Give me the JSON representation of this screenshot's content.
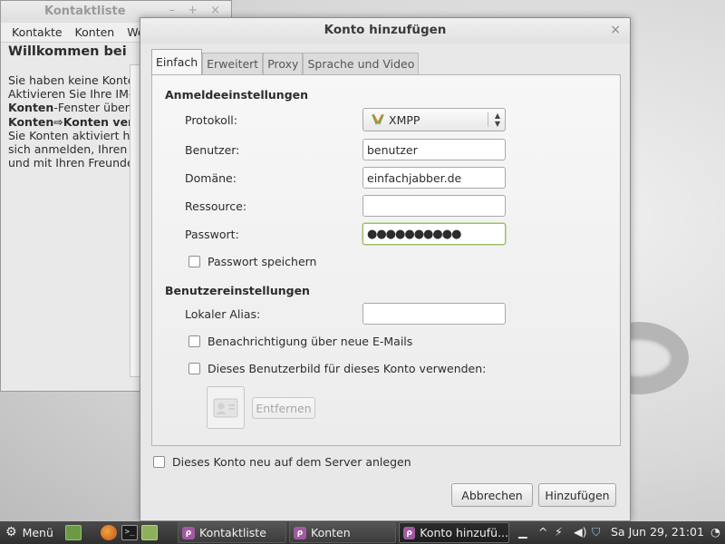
{
  "background_window": {
    "title": "Kontaktliste",
    "controls": [
      "–",
      "+",
      "×"
    ],
    "menu": [
      "Kontakte",
      "Konten",
      "We"
    ],
    "welcome": "Willkommen bei",
    "lines": [
      {
        "text": "Sie haben keine Konte"
      },
      {
        "text": "Aktivieren Sie Ihre IM-"
      },
      {
        "bold": "Konten",
        "text": "-Fenster über"
      },
      {
        "bold": "Konten⇨Konten ver",
        "text": ""
      },
      {
        "text": "Sie Konten aktiviert ha"
      },
      {
        "text": "sich anmelden, Ihren"
      },
      {
        "text": "und mit Ihren Freunde"
      }
    ]
  },
  "dialog": {
    "title": "Konto hinzufügen",
    "close": "×",
    "tabs": [
      "Einfach",
      "Erweitert",
      "Proxy",
      "Sprache und Video"
    ],
    "active_tab": "Einfach",
    "login_section": "Anmeldeeinstellungen",
    "protocol_label": "Protokoll:",
    "protocol_value": "XMPP",
    "username_label": "Benutzer:",
    "username_value": "benutzer",
    "domain_label": "Domäne:",
    "domain_value": "einfachjabber.de",
    "resource_label": "Ressource:",
    "resource_value": "",
    "password_label": "Passwort:",
    "password_value": "●●●●●●●●●●",
    "remember_password": "Passwort speichern",
    "user_section": "Benutzereinstellungen",
    "alias_label": "Lokaler Alias:",
    "alias_value": "",
    "new_mail_notify": "Benachrichtigung über neue E-Mails",
    "use_buddy_icon": "Dieses Benutzerbild für dieses Konto verwenden:",
    "remove_button": "Entfernen",
    "register_account": "Dieses Konto neu auf dem Server anlegen",
    "cancel_button": "Abbrechen",
    "add_button": "Hinzufügen"
  },
  "taskbar": {
    "menu_label": "Menü",
    "tasks": [
      "Kontaktliste",
      "Konten",
      "Konto hinzufü..."
    ],
    "clock": "Sa Jun 29, 21:01"
  },
  "colors": {
    "xmpp_green": "#6aa84f",
    "focus_border": "#9cbc6e",
    "pidgin_purple": "#a05aa0"
  }
}
